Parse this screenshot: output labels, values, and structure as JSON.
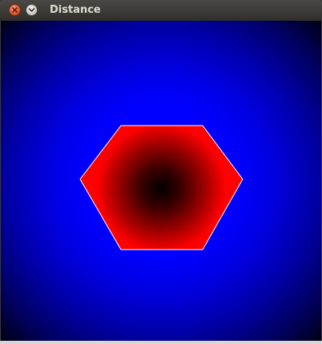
{
  "window": {
    "title": "Distance",
    "buttons": {
      "close_icon": "close-icon",
      "menu_icon": "chevron-down-icon"
    }
  },
  "canvas": {
    "background_color_center": "#0000ff",
    "background_color_edge": "#000010",
    "shape": "hexagon",
    "shape_fill_edge": "#ff0000",
    "shape_fill_center": "#000000",
    "shape_outline": "#ffffff"
  }
}
